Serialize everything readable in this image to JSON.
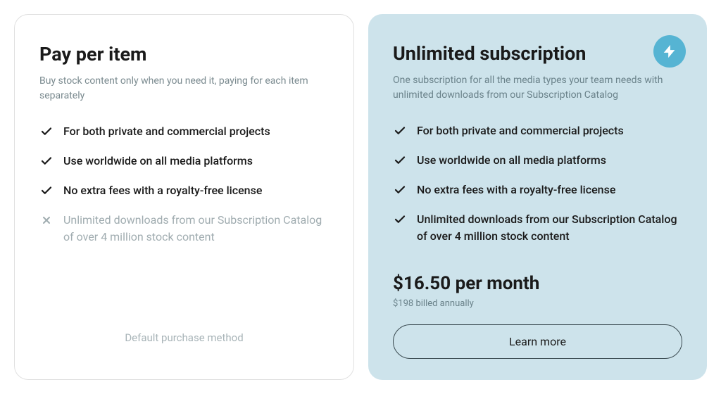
{
  "plans": {
    "pay_per_item": {
      "title": "Pay per item",
      "description": "Buy stock content only when you need it, paying for each item separately",
      "features": [
        {
          "text": "For both private and commercial projects",
          "included": true
        },
        {
          "text": "Use worldwide on all media platforms",
          "included": true
        },
        {
          "text": "No extra fees with a royalty-free license",
          "included": true
        },
        {
          "text": "Unlimited downloads from our Subscription Catalog of over 4 million stock content",
          "included": false
        }
      ],
      "footer_label": "Default purchase method"
    },
    "unlimited": {
      "title": "Unlimited subscription",
      "description": "One subscription for all the media types your team needs with unlimited downloads from our Subscription Catalog",
      "features": [
        {
          "text": "For both private and commercial projects",
          "included": true
        },
        {
          "text": "Use worldwide on all media platforms",
          "included": true
        },
        {
          "text": "No extra fees with a royalty-free license",
          "included": true
        },
        {
          "text": "Unlimited downloads from our Subscription Catalog of over 4 million stock content",
          "included": true
        }
      ],
      "price": "$16.50 per month",
      "price_sub": "$198 billed annually",
      "cta_label": "Learn more"
    }
  }
}
